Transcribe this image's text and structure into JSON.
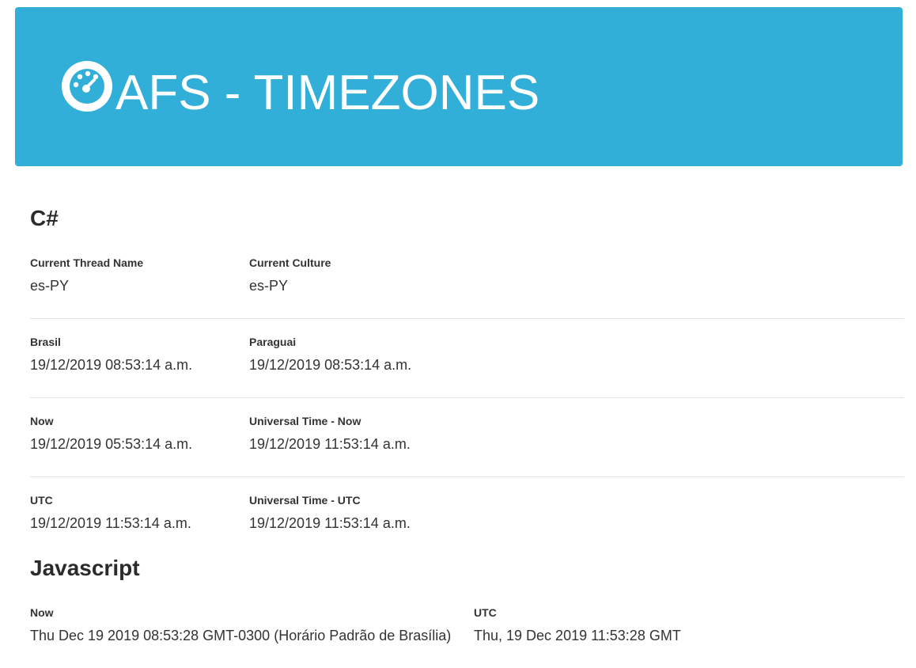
{
  "header": {
    "icon": "dashboard-gauge-icon",
    "title": "AFS - TIMEZONES",
    "background_color": "#31afd8"
  },
  "csharp": {
    "title": "C#",
    "rows": [
      [
        {
          "label": "Current Thread Name",
          "value": "es-PY"
        },
        {
          "label": "Current Culture",
          "value": "es-PY"
        }
      ],
      [
        {
          "label": "Brasil",
          "value": "19/12/2019 08:53:14 a.m."
        },
        {
          "label": "Paraguai",
          "value": "19/12/2019 08:53:14 a.m."
        }
      ],
      [
        {
          "label": "Now",
          "value": "19/12/2019 05:53:14 a.m."
        },
        {
          "label": "Universal Time - Now",
          "value": "19/12/2019 11:53:14 a.m."
        }
      ],
      [
        {
          "label": "UTC",
          "value": "19/12/2019 11:53:14 a.m."
        },
        {
          "label": "Universal Time - UTC",
          "value": "19/12/2019 11:53:14 a.m."
        }
      ]
    ]
  },
  "javascript": {
    "title": "Javascript",
    "rows": [
      [
        {
          "label": "Now",
          "value": "Thu Dec 19 2019 08:53:28 GMT-0300 (Horário Padrão de Brasília)"
        },
        {
          "label": "UTC",
          "value": "Thu, 19 Dec 2019 11:53:28 GMT"
        }
      ]
    ]
  }
}
